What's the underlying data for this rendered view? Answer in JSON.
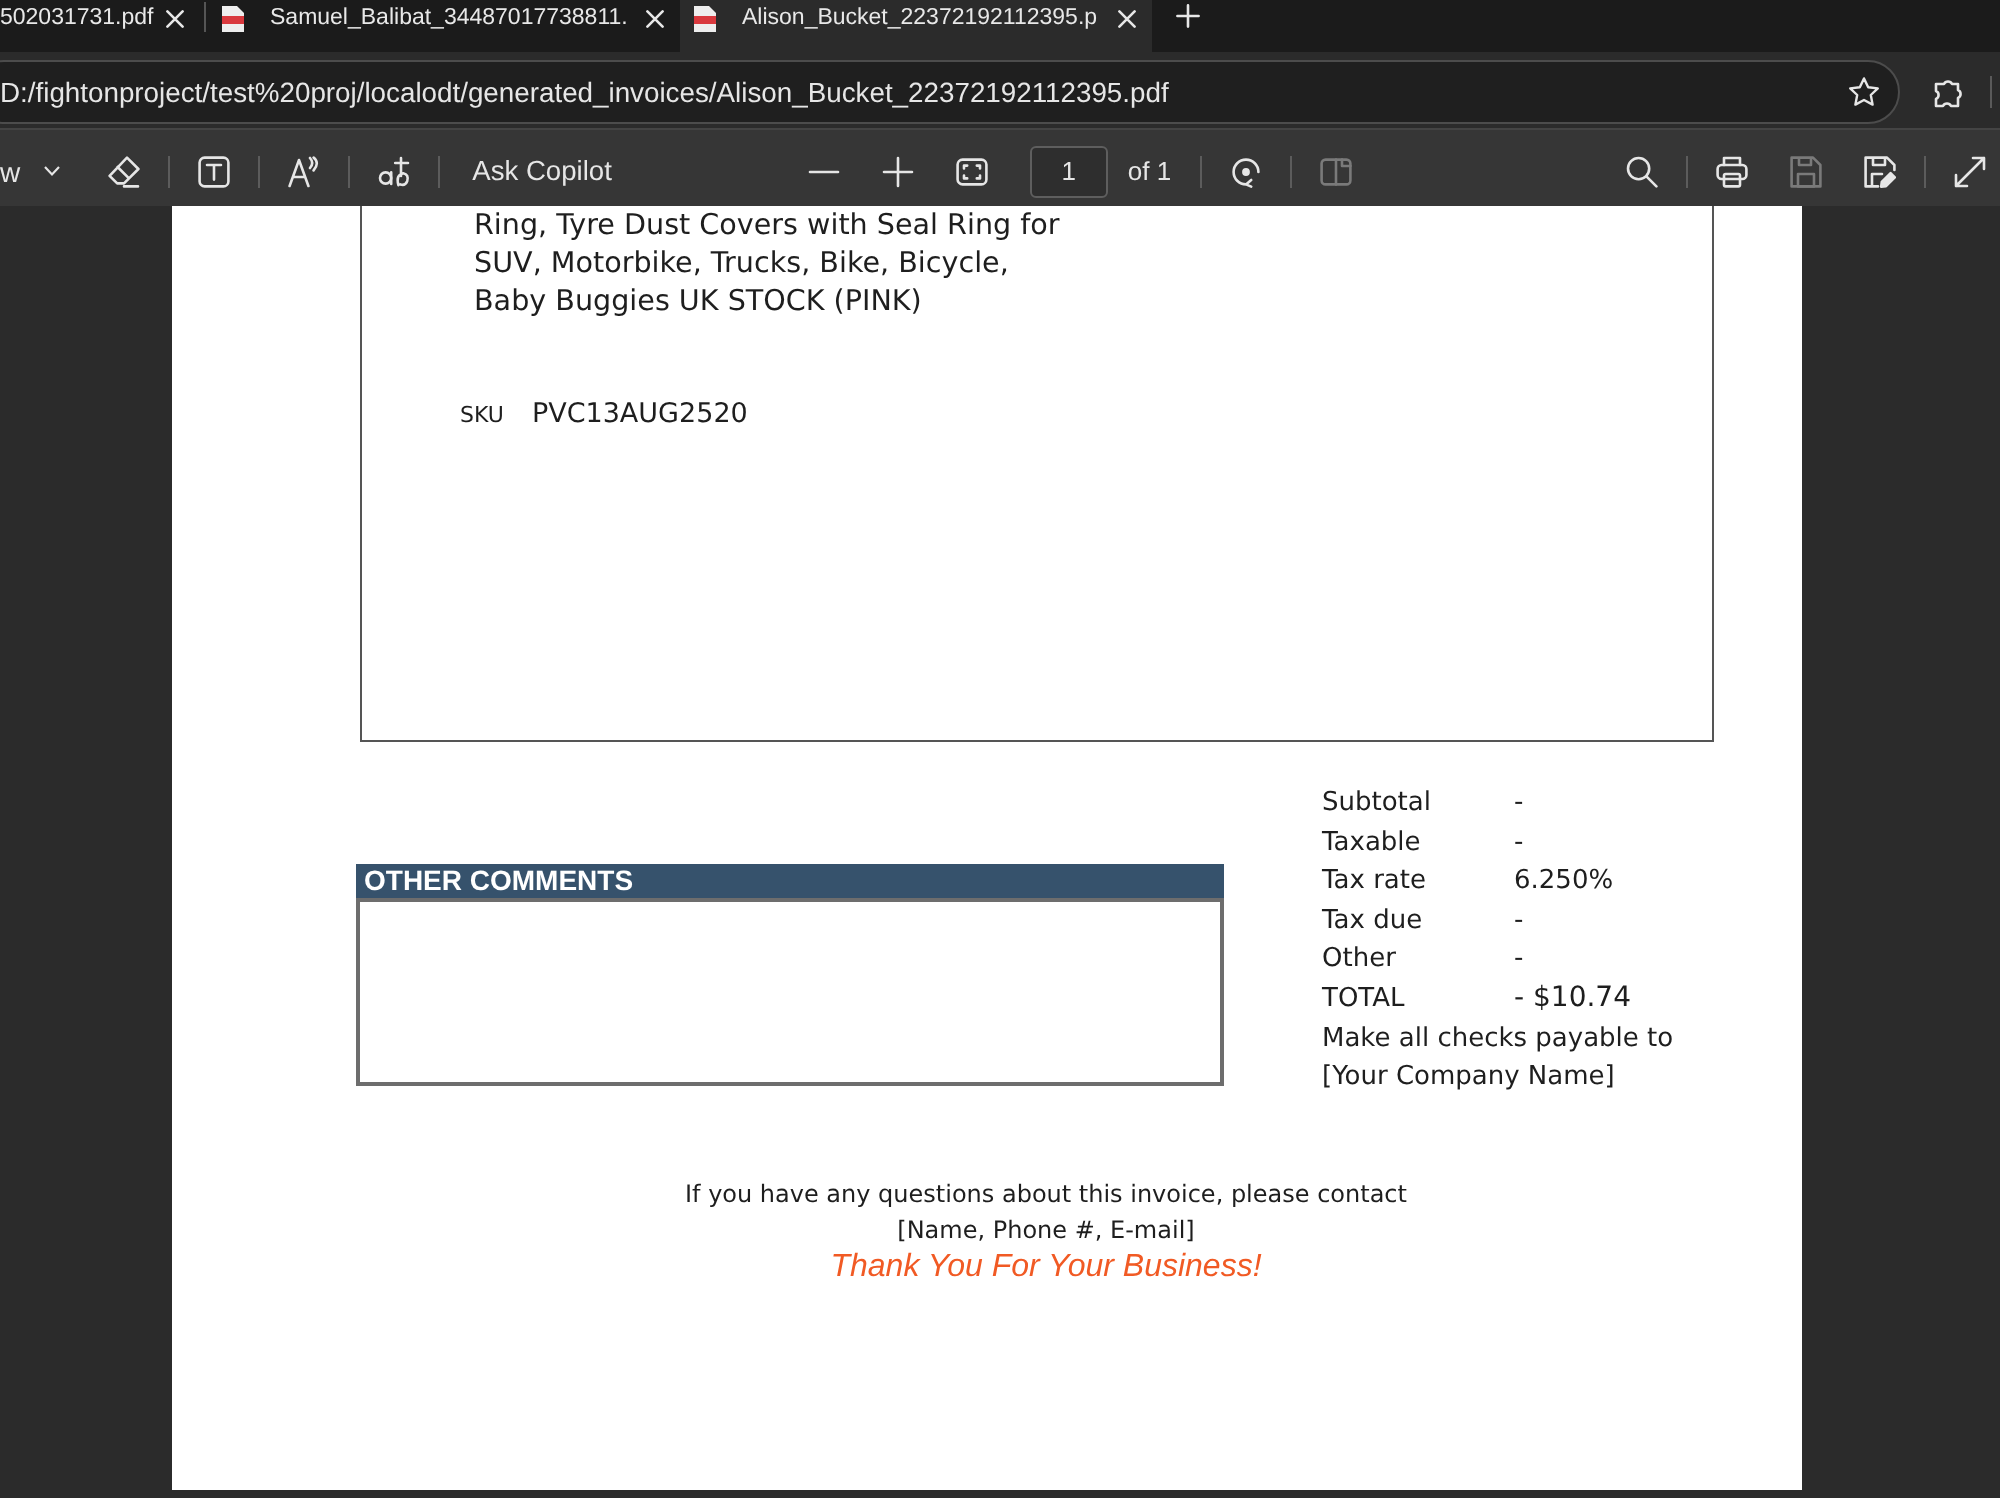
{
  "browser": {
    "tabs": [
      {
        "title": "502031731.pdf",
        "kind": "plain",
        "selected": false
      },
      {
        "title": "Samuel_Balibat_34487017738811.",
        "kind": "pdf",
        "selected": false
      },
      {
        "title": "Alison_Bucket_22372192112395.p",
        "kind": "pdf",
        "selected": true
      }
    ],
    "address_bar": {
      "url": "D:/fightonproject/test%20proj/localodt/generated_invoices/Alison_Bucket_22372192112395.pdf"
    }
  },
  "pdf_toolbar": {
    "left": [
      [
        {
          "kind": "draw",
          "label": "w",
          "disabled": false
        },
        {
          "kind": "eraser",
          "disabled": false
        }
      ],
      [
        {
          "kind": "textbox",
          "disabled": false
        }
      ],
      [
        {
          "kind": "read",
          "disabled": false
        }
      ],
      [
        {
          "kind": "translate",
          "disabled": false
        }
      ],
      [
        {
          "kind": "copilot",
          "label": "Ask Copilot",
          "disabled": false
        }
      ]
    ],
    "center": [
      [
        {
          "kind": "zoomout",
          "disabled": false
        },
        {
          "kind": "zoomin",
          "disabled": false
        },
        {
          "kind": "fit",
          "disabled": false
        },
        {
          "kind": "page",
          "value": "1",
          "total": "of 1",
          "disabled": false
        }
      ],
      [
        {
          "kind": "rotate",
          "disabled": false
        }
      ],
      [
        {
          "kind": "twopage",
          "disabled": true
        }
      ]
    ],
    "right": [
      [
        {
          "kind": "search",
          "disabled": false
        }
      ],
      [
        {
          "kind": "print",
          "disabled": false
        },
        {
          "kind": "save",
          "disabled": true
        },
        {
          "kind": "saveas",
          "disabled": false
        }
      ],
      [
        {
          "kind": "fullscreen",
          "disabled": false
        }
      ]
    ]
  },
  "invoice": {
    "item_description": [
      "Ring, Tyre Dust Covers with Seal Ring for",
      "SUV, Motorbike, Trucks, Bike, Bicycle,",
      "Baby Buggies UK STOCK (PINK)"
    ],
    "sku": {
      "label": "SKU",
      "value": "PVC13AUG2520"
    },
    "comments": {
      "title": "OTHER COMMENTS"
    },
    "totals": [
      {
        "label": "Subtotal",
        "value": "-",
        "kind": "line"
      },
      {
        "label": "Taxable",
        "value": "-",
        "kind": "line"
      },
      {
        "label": "Tax rate",
        "value": "6.250%",
        "kind": "line"
      },
      {
        "label": "Tax due",
        "value": "-",
        "kind": "line"
      },
      {
        "label": "Other",
        "value": "-",
        "kind": "line"
      },
      {
        "label": "TOTAL",
        "value": "- $10.74",
        "kind": "total"
      }
    ],
    "payable_note": [
      "Make all checks payable to",
      "[Your Company Name]"
    ],
    "contact_note": [
      "If you have any questions about this invoice, please contact",
      "[Name, Phone #, E-mail]"
    ],
    "thanks": "Thank You For Your Business!"
  }
}
